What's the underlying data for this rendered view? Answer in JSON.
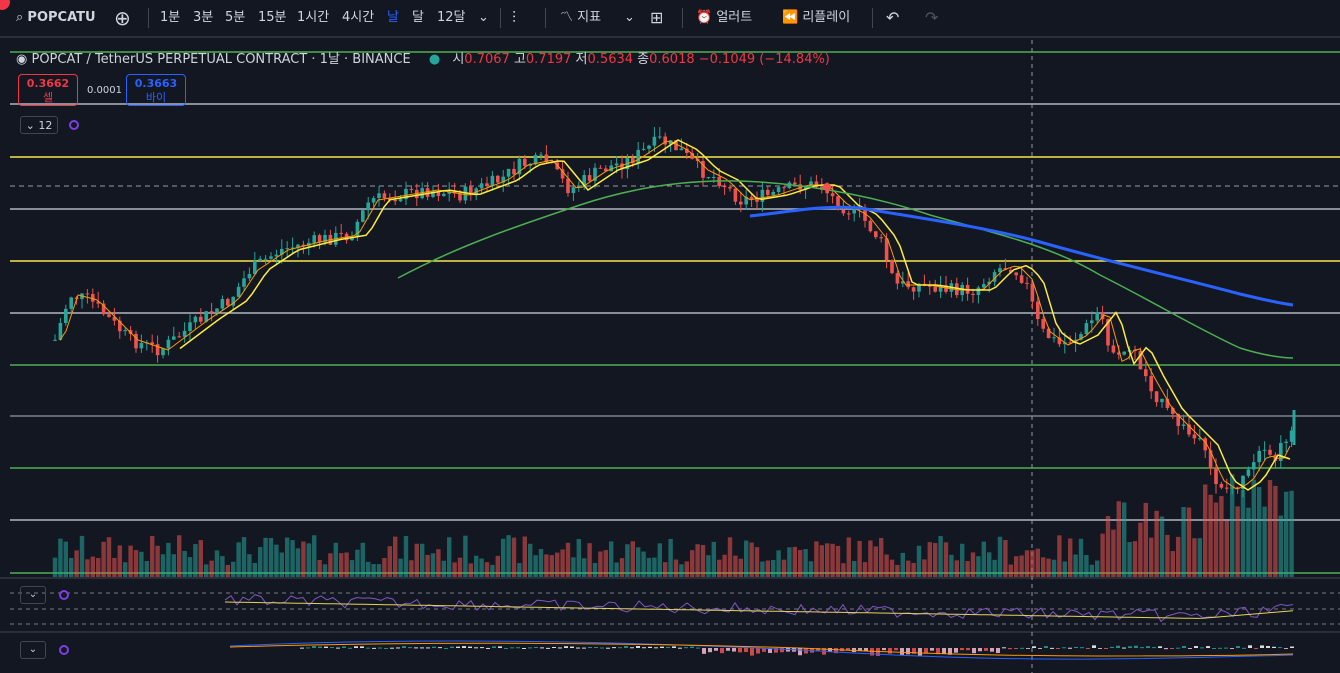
{
  "toolbar": {
    "symbol": "POPCATU",
    "intervals": [
      "1분",
      "3분",
      "5분",
      "15분",
      "1시간",
      "4시간",
      "날",
      "달",
      "12달"
    ],
    "active_interval": "날",
    "indicators_label": "지표",
    "alert_label": "얼러트",
    "replay_label": "리플레이"
  },
  "legend": {
    "title": "POPCAT / TetherUS PERPETUAL CONTRACT · 1날 · BINANCE",
    "open_label": "시",
    "open": "0.7067",
    "high_label": "고",
    "high": "0.7197",
    "low_label": "저",
    "low": "0.5634",
    "close_label": "종",
    "close": "0.6018",
    "change": "−0.1049 (−14.84%)"
  },
  "trade": {
    "sell_price": "0.3662",
    "sell_label": "셀",
    "spread": "0.0001",
    "buy_price": "0.3663",
    "buy_label": "바이"
  },
  "collapse_count": "12",
  "colors": {
    "up": "#26a69a",
    "down": "#ef5350",
    "yellow_level": "#f5e74a",
    "green_level": "#4caf50",
    "gray_level": "#b2b5be",
    "blue_ma": "#2962ff",
    "green_ma": "#4caf50",
    "orange_ma": "#ff9800",
    "yellow_ma": "#ffeb3b"
  },
  "icons": [
    "search-icon",
    "add-symbol-icon",
    "candle-style-icon",
    "indicators-icon",
    "layout-icon",
    "alert-icon",
    "replay-icon",
    "undo-icon",
    "redo-icon"
  ]
}
